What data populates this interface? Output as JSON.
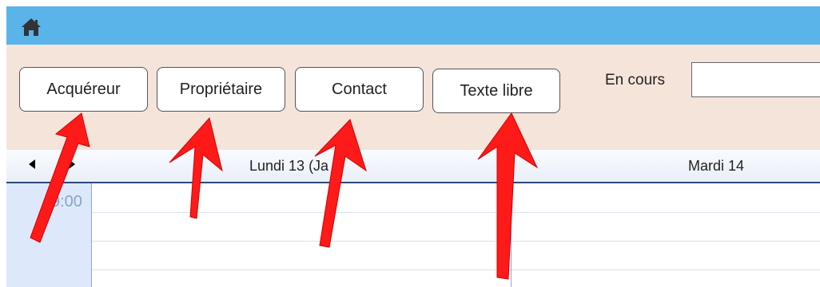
{
  "topbar": {
    "home_icon": "home-icon",
    "color": "#5ab4ea"
  },
  "toolbar": {
    "buttons": [
      {
        "label": "Acquéreur"
      },
      {
        "label": "Propriétaire"
      },
      {
        "label": "Contact"
      },
      {
        "label": "Texte libre"
      }
    ],
    "en_cours_label": "En cours",
    "en_cours_value": ""
  },
  "calendar": {
    "days": [
      {
        "label": "Lundi 13 (Ja"
      },
      {
        "label": "Mardi 14"
      }
    ],
    "times": [
      "9:00"
    ]
  },
  "annotation": {
    "arrow_color": "#ff1a1a"
  }
}
